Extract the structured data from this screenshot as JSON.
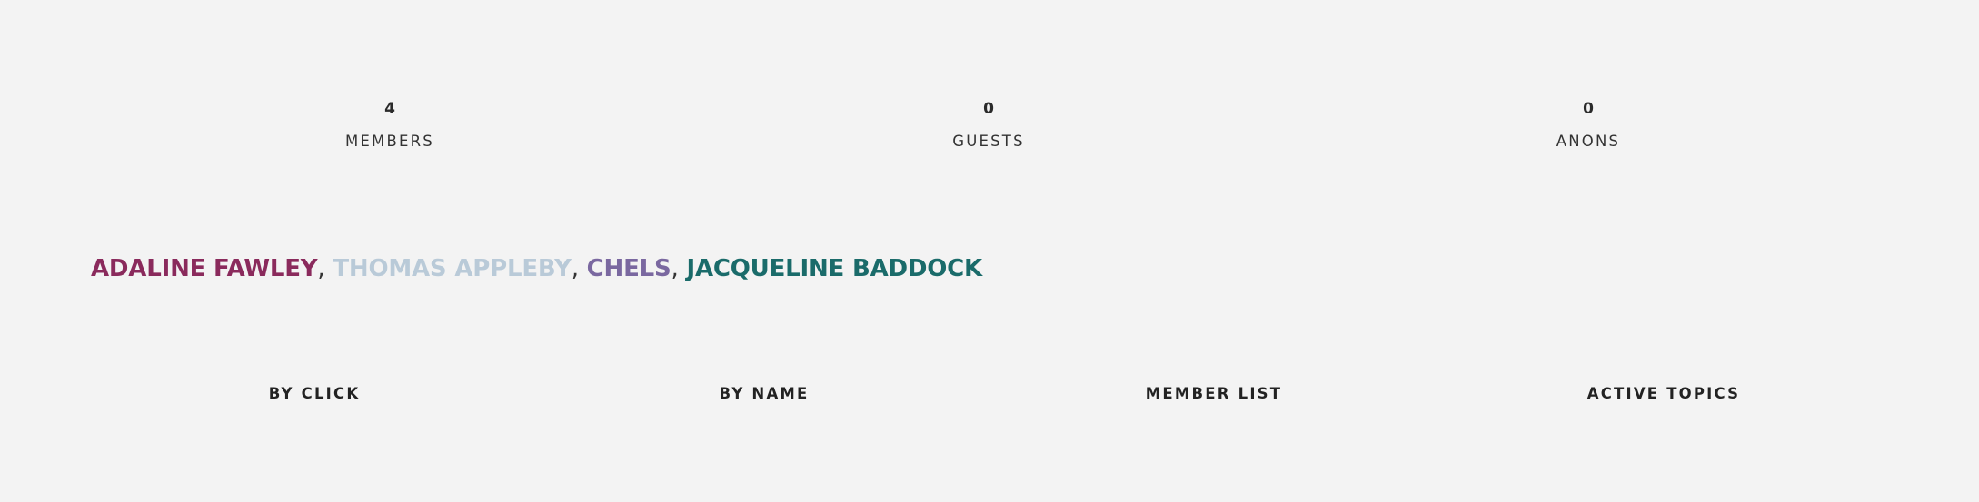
{
  "stats": [
    {
      "count": "4",
      "label": "MEMBERS"
    },
    {
      "count": "0",
      "label": "GUESTS"
    },
    {
      "count": "0",
      "label": "ANONS"
    }
  ],
  "online_members": [
    {
      "name": "ADALINE FAWLEY",
      "color": "#8a2a5c"
    },
    {
      "name": "THOMAS APPLEBY",
      "color": "#b9cad8"
    },
    {
      "name": "CHELS",
      "color": "#7a68a0"
    },
    {
      "name": "JACQUELINE BADDOCK",
      "color": "#1a6b6a"
    }
  ],
  "separator": ",",
  "links": [
    {
      "label": "BY CLICK"
    },
    {
      "label": "BY NAME"
    },
    {
      "label": "MEMBER LIST"
    },
    {
      "label": "ACTIVE TOPICS"
    }
  ]
}
